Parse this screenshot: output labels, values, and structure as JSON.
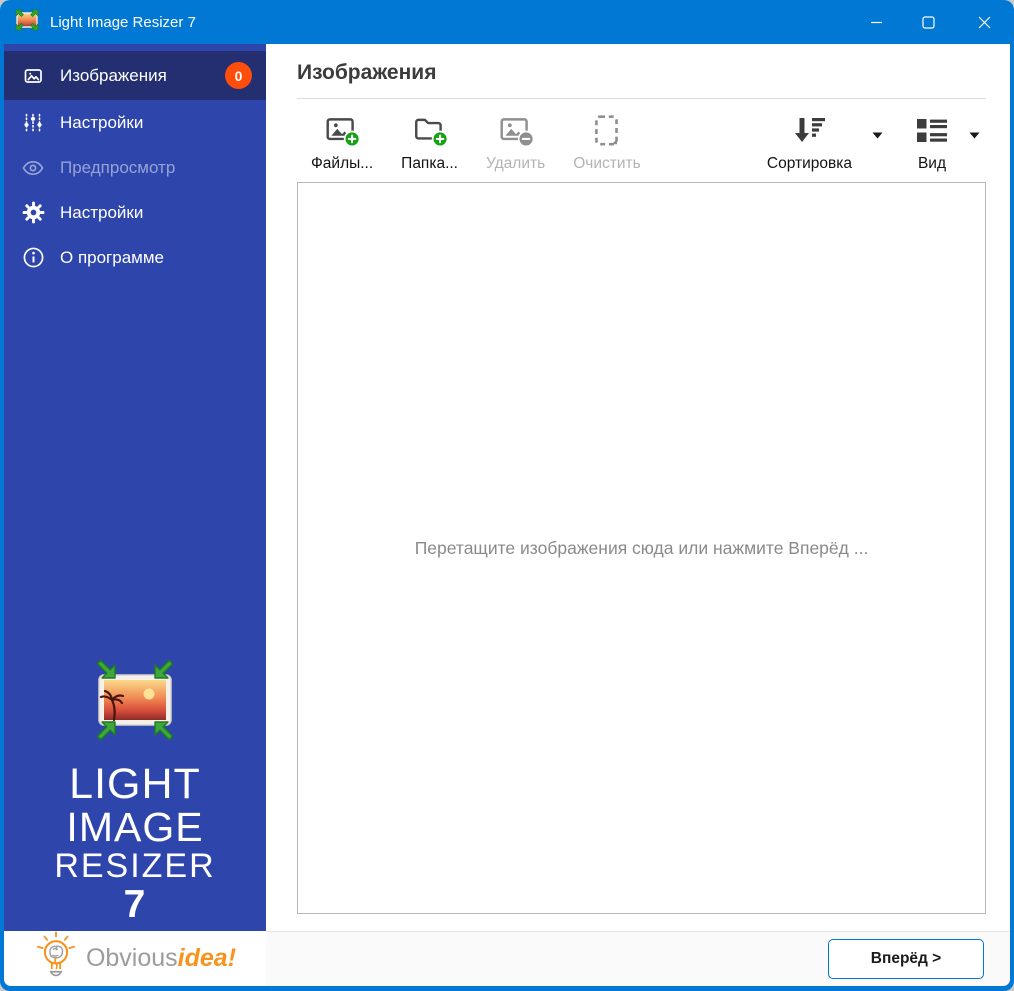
{
  "window": {
    "title": "Light Image Resizer 7"
  },
  "sidebar": {
    "items": [
      {
        "label": "Изображения",
        "icon": "images-icon",
        "badge": "0",
        "active": true,
        "disabled": false
      },
      {
        "label": "Настройки",
        "icon": "sliders-icon",
        "active": false,
        "disabled": false
      },
      {
        "label": "Предпросмотр",
        "icon": "eye-icon",
        "active": false,
        "disabled": true
      },
      {
        "label": "Настройки",
        "icon": "gear-icon",
        "active": false,
        "disabled": false
      },
      {
        "label": "О программе",
        "icon": "info-icon",
        "active": false,
        "disabled": false
      }
    ],
    "logo_lines": [
      "LIGHT",
      "IMAGE",
      "RESIZER",
      "7"
    ],
    "brand": {
      "gray": "Obvious",
      "orange": "idea!"
    }
  },
  "main": {
    "header": "Изображения",
    "toolbar": [
      {
        "label": "Файлы...",
        "icon": "add-files-icon",
        "enabled": true
      },
      {
        "label": "Папка...",
        "icon": "add-folder-icon",
        "enabled": true
      },
      {
        "label": "Удалить",
        "icon": "remove-image-icon",
        "enabled": false
      },
      {
        "label": "Очистить",
        "icon": "clear-selection-icon",
        "enabled": false
      },
      {
        "label": "Сортировка",
        "icon": "sort-icon",
        "enabled": true,
        "dropdown": true
      },
      {
        "label": "Вид",
        "icon": "view-icon",
        "enabled": true,
        "dropdown": true
      }
    ],
    "dropzone_hint": "Перетащите изображения сюда или нажмите Вперёд ...",
    "next_button": "Вперёд >"
  },
  "colors": {
    "accent": "#0078D4",
    "sidebar": "#2E46AC",
    "sidebar_active": "#232F70",
    "badge": "#FF4E0B",
    "green": "#15A315",
    "orange": "#F7941E"
  }
}
